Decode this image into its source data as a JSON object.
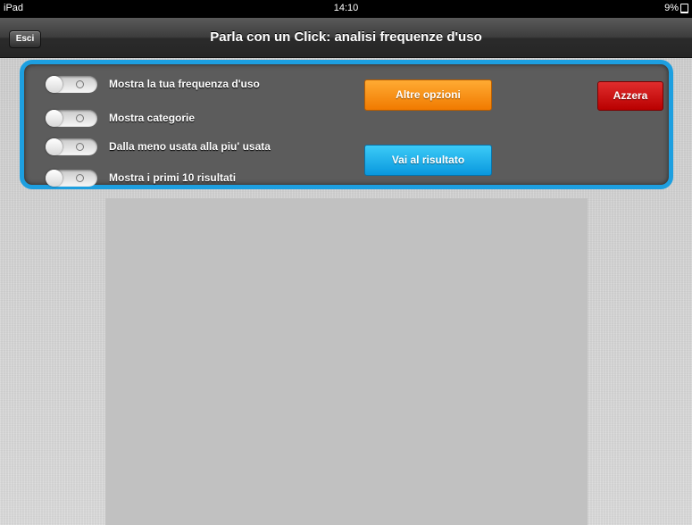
{
  "status_bar": {
    "device": "iPad",
    "time": "14:10",
    "battery": "9%",
    "battery_level": 0.09
  },
  "nav": {
    "back_label": "Esci",
    "title": "Parla con un Click: analisi frequenze d'uso"
  },
  "options": {
    "toggles": [
      {
        "label": "Mostra la tua frequenza d'uso",
        "on": false
      },
      {
        "label": "Mostra categorie",
        "on": false
      },
      {
        "label": "Dalla meno usata alla piu' usata",
        "on": false
      },
      {
        "label": "Mostra i primi 10 risultati",
        "on": false
      }
    ],
    "more_options_label": "Altre opzioni",
    "go_to_result_label": "Vai al risultato",
    "reset_label": "Azzera"
  },
  "colors": {
    "panel_border": "#1d9fe0",
    "orange_button": "#f17a00",
    "blue_button": "#0998de",
    "red_button": "#c00000"
  }
}
